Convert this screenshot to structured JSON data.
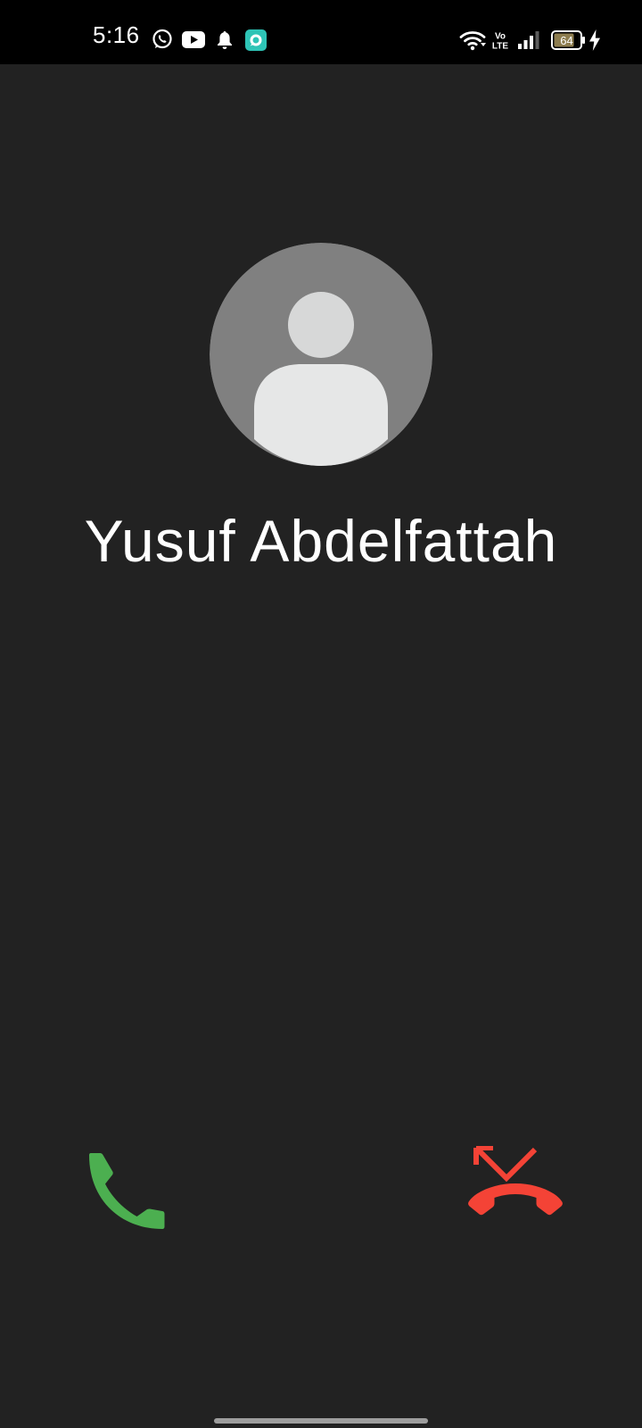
{
  "status_bar": {
    "time": "5:16",
    "battery_level": "64",
    "notification_icons": [
      "whatsapp-icon",
      "youtube-icon",
      "bell-icon",
      "app-notification-icon"
    ],
    "system_icons": [
      "wifi-icon",
      "volte-icon",
      "signal-icon",
      "battery-icon",
      "charging-icon"
    ],
    "volte_line1": "Vo",
    "volte_line2": "LTE"
  },
  "call": {
    "caller_name": "Yusuf Abdelfattah"
  },
  "colors": {
    "background": "#222222",
    "status_bar": "#000000",
    "answer": "#4caf50",
    "decline": "#f44336",
    "avatar_bg": "#808080",
    "avatar_figure": "#e6e7e7",
    "app_icon": "#2ec4b6"
  }
}
